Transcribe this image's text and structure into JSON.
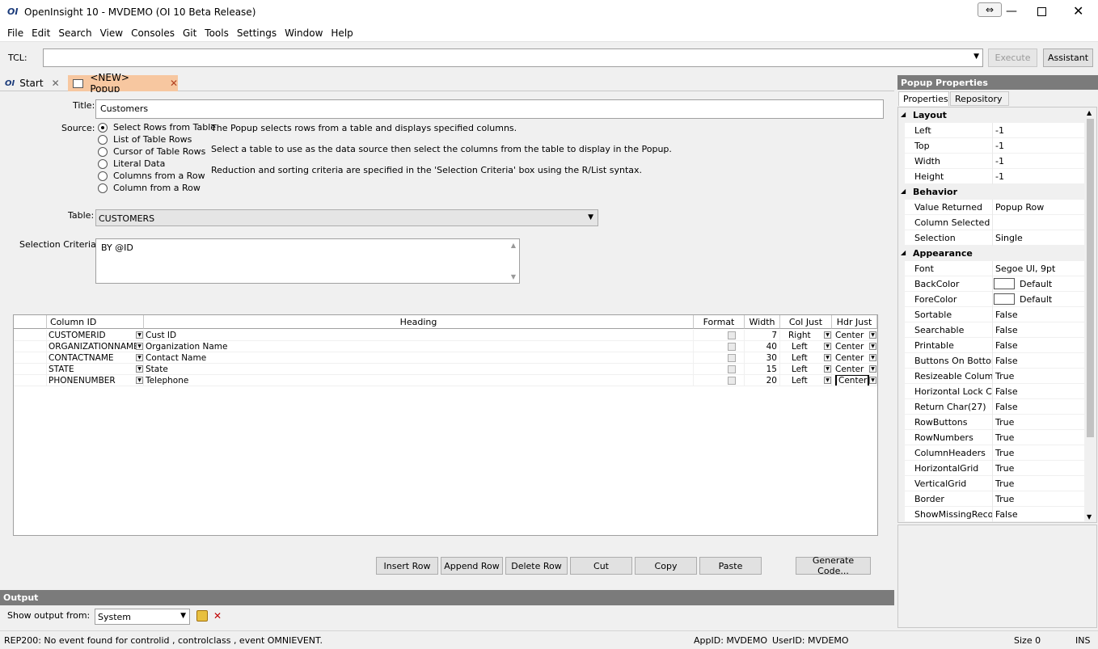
{
  "window": {
    "title": "OpenInsight 10 - MVDEMO (OI 10 Beta Release)"
  },
  "menu": [
    "File",
    "Edit",
    "Search",
    "View",
    "Consoles",
    "Git",
    "Tools",
    "Settings",
    "Window",
    "Help"
  ],
  "tcl": {
    "label": "TCL:",
    "value": "",
    "execute": "Execute",
    "assistant": "Assistant"
  },
  "tabs": [
    {
      "label": "Start"
    },
    {
      "label": "<NEW> Popup"
    }
  ],
  "form": {
    "title_label": "Title:",
    "title_value": "Customers",
    "source_label": "Source:",
    "sources": [
      "Select Rows from Table",
      "List of Table Rows",
      "Cursor of Table Rows",
      "Literal Data",
      "Columns from a Row",
      "Column from a Row"
    ],
    "source_selected": 0,
    "desc1": "The Popup selects rows from a table and displays specified columns.",
    "desc2": "Select a table to use as the data source then select the columns from the table to display in the Popup.",
    "desc3": "Reduction and sorting criteria are specified in the 'Selection Criteria' box using the R/List syntax.",
    "table_label": "Table:",
    "table_value": "CUSTOMERS",
    "criteria_label": "Selection Criteria:",
    "criteria_value": "BY @ID"
  },
  "grid": {
    "headers": [
      "Column ID",
      "Heading",
      "Format",
      "Width",
      "Col Just",
      "Hdr Just"
    ],
    "rows": [
      {
        "col": "CUSTOMERID",
        "heading": "Cust ID",
        "width": "7",
        "colj": "Right",
        "hdrj": "Center"
      },
      {
        "col": "ORGANIZATIONNAME",
        "heading": "Organization Name",
        "width": "40",
        "colj": "Left",
        "hdrj": "Center"
      },
      {
        "col": "CONTACTNAME",
        "heading": "Contact Name",
        "width": "30",
        "colj": "Left",
        "hdrj": "Center"
      },
      {
        "col": "STATE",
        "heading": "State",
        "width": "15",
        "colj": "Left",
        "hdrj": "Center"
      },
      {
        "col": "PHONENUMBER",
        "heading": "Telephone",
        "width": "20",
        "colj": "Left",
        "hdrj": "Center"
      }
    ]
  },
  "buttons": {
    "insert": "Insert Row",
    "append": "Append Row",
    "delete": "Delete Row",
    "cut": "Cut",
    "copy": "Copy",
    "paste": "Paste",
    "generate": "Generate Code..."
  },
  "output": {
    "title": "Output",
    "label": "Show output from:",
    "value": "System"
  },
  "props": {
    "title": "Popup Properties",
    "tabs": [
      "Properties",
      "Repository"
    ],
    "items": [
      {
        "cat": "Layout"
      },
      {
        "k": "Left",
        "v": "-1"
      },
      {
        "k": "Top",
        "v": "-1"
      },
      {
        "k": "Width",
        "v": "-1"
      },
      {
        "k": "Height",
        "v": "-1"
      },
      {
        "cat": "Behavior"
      },
      {
        "k": "Value Returned",
        "v": "Popup Row"
      },
      {
        "k": "Column Selected",
        "v": ""
      },
      {
        "k": "Selection",
        "v": "Single"
      },
      {
        "cat": "Appearance"
      },
      {
        "k": "Font",
        "v": "Segoe UI, 9pt"
      },
      {
        "k": "BackColor",
        "v": "Default",
        "swatch": true
      },
      {
        "k": "ForeColor",
        "v": "Default",
        "swatch": true
      },
      {
        "k": "Sortable",
        "v": "False"
      },
      {
        "k": "Searchable",
        "v": "False"
      },
      {
        "k": "Printable",
        "v": "False"
      },
      {
        "k": "Buttons On Bottom",
        "v": "False"
      },
      {
        "k": "Resizeable Columns",
        "v": "True"
      },
      {
        "k": "Horizontal Lock Co",
        "v": "False"
      },
      {
        "k": "Return Char(27)",
        "v": "False"
      },
      {
        "k": "RowButtons",
        "v": "True"
      },
      {
        "k": "RowNumbers",
        "v": "True"
      },
      {
        "k": "ColumnHeaders",
        "v": "True"
      },
      {
        "k": "HorizontalGrid",
        "v": "True"
      },
      {
        "k": "VerticalGrid",
        "v": "True"
      },
      {
        "k": "Border",
        "v": "True"
      },
      {
        "k": "ShowMissingReco",
        "v": "False"
      }
    ]
  },
  "status": {
    "message": "REP200:  No event found for controlid , controlclass , event OMNIEVENT.",
    "appid": "AppID: MVDEMO",
    "userid": "UserID: MVDEMO",
    "size": "Size 0",
    "mode": "INS"
  }
}
